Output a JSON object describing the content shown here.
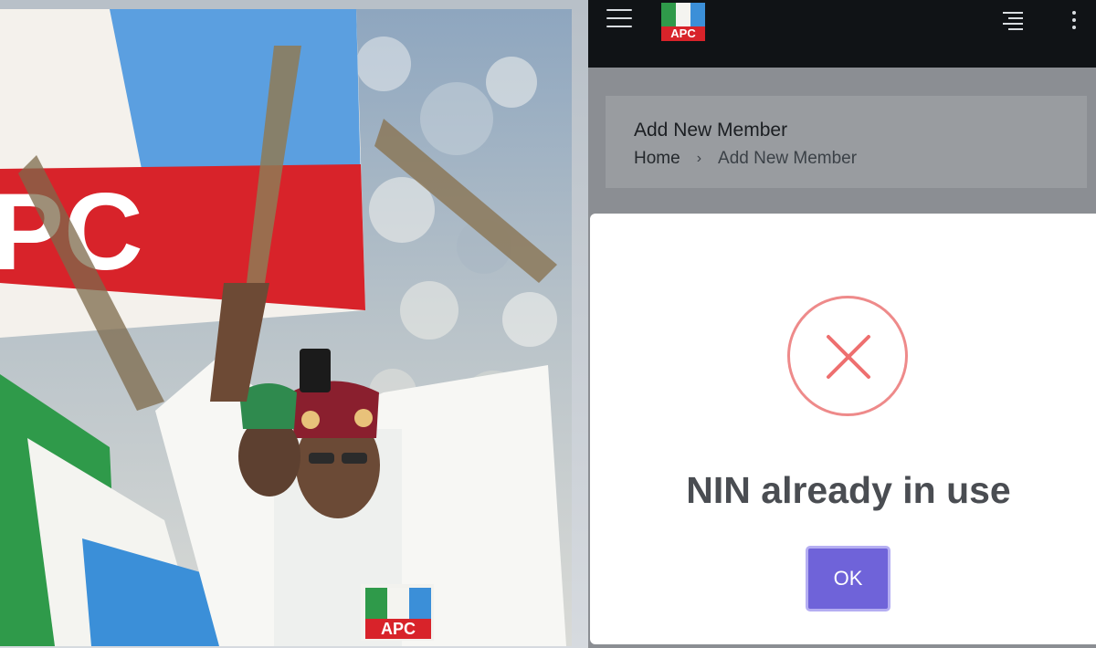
{
  "header": {
    "logo_text": "APC",
    "menu_icon": "hamburger-menu-icon",
    "align_icon": "text-align-right-icon",
    "more_icon": "more-vertical-icon"
  },
  "page": {
    "title": "Add New Member",
    "breadcrumb": [
      "Home",
      "Add New Member"
    ]
  },
  "modal": {
    "icon": "error-x-icon",
    "message": "NIN already in use",
    "ok_label": "OK"
  },
  "photo": {
    "description_icon": "rally-photo",
    "flag_text": "PC",
    "badge_text": "APC"
  },
  "colors": {
    "brand_red": "#d8232a",
    "brand_green": "#2f9a4a",
    "brand_blue": "#3b8fd8",
    "button_purple": "#6f63d9",
    "error_red": "#ee8a8a"
  }
}
